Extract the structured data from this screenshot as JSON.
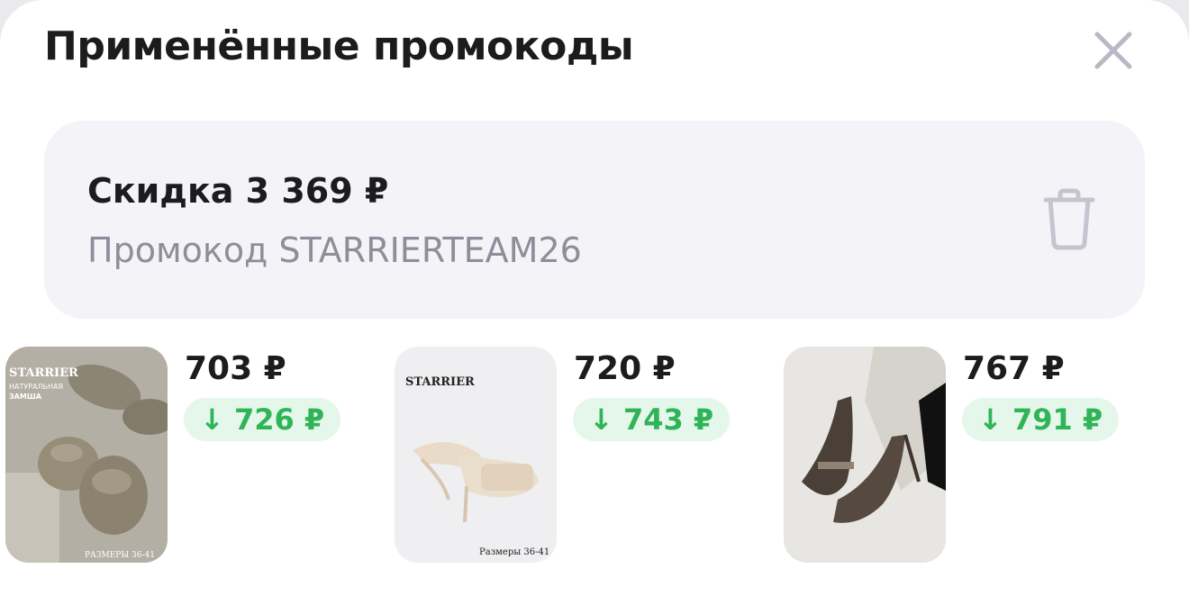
{
  "header": {
    "title": "Применённые промокоды"
  },
  "promo": {
    "discount": "Скидка 3 369 ₽",
    "code": "Промокод STARRIERTEAM26"
  },
  "products": [
    {
      "price": "703 ₽",
      "old_price": "↓ 726 ₽",
      "image_texts": [
        "STARRIER",
        "НАТУРАЛЬНАЯ",
        "ЗАМША",
        "РАЗМЕРЫ 36-41"
      ]
    },
    {
      "price": "720 ₽",
      "old_price": "↓ 743 ₽",
      "image_texts": [
        "STARRIER",
        "Размеры 36-41"
      ]
    },
    {
      "price": "767 ₽",
      "old_price": "↓ 791 ₽",
      "image_texts": []
    }
  ],
  "colors": {
    "accent_green": "#2fb457",
    "badge_bg": "#e5f7ea",
    "card_bg": "#f3f3f8",
    "muted_text": "#8e8e9a"
  },
  "icons": {
    "close": "close-icon",
    "trash": "trash-icon",
    "arrow_down": "arrow-down-icon"
  }
}
